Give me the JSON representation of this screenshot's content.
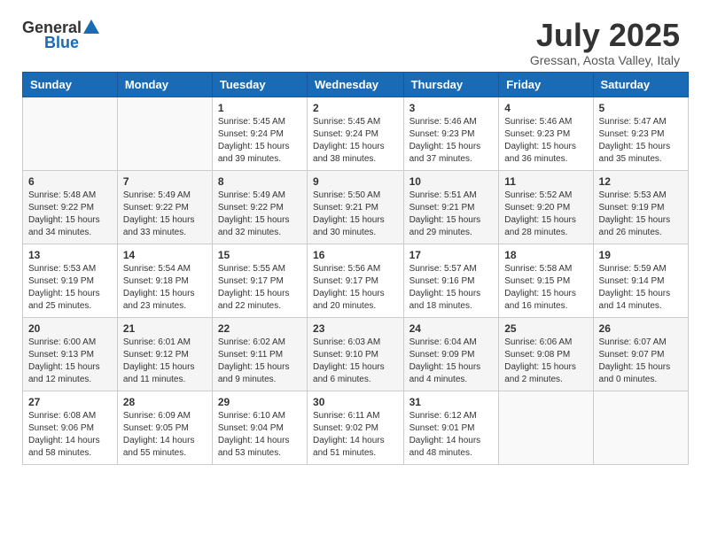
{
  "logo": {
    "general": "General",
    "blue": "Blue"
  },
  "title": "July 2025",
  "location": "Gressan, Aosta Valley, Italy",
  "headers": [
    "Sunday",
    "Monday",
    "Tuesday",
    "Wednesday",
    "Thursday",
    "Friday",
    "Saturday"
  ],
  "weeks": [
    [
      {
        "day": "",
        "info": ""
      },
      {
        "day": "",
        "info": ""
      },
      {
        "day": "1",
        "info": "Sunrise: 5:45 AM\nSunset: 9:24 PM\nDaylight: 15 hours and 39 minutes."
      },
      {
        "day": "2",
        "info": "Sunrise: 5:45 AM\nSunset: 9:24 PM\nDaylight: 15 hours and 38 minutes."
      },
      {
        "day": "3",
        "info": "Sunrise: 5:46 AM\nSunset: 9:23 PM\nDaylight: 15 hours and 37 minutes."
      },
      {
        "day": "4",
        "info": "Sunrise: 5:46 AM\nSunset: 9:23 PM\nDaylight: 15 hours and 36 minutes."
      },
      {
        "day": "5",
        "info": "Sunrise: 5:47 AM\nSunset: 9:23 PM\nDaylight: 15 hours and 35 minutes."
      }
    ],
    [
      {
        "day": "6",
        "info": "Sunrise: 5:48 AM\nSunset: 9:22 PM\nDaylight: 15 hours and 34 minutes."
      },
      {
        "day": "7",
        "info": "Sunrise: 5:49 AM\nSunset: 9:22 PM\nDaylight: 15 hours and 33 minutes."
      },
      {
        "day": "8",
        "info": "Sunrise: 5:49 AM\nSunset: 9:22 PM\nDaylight: 15 hours and 32 minutes."
      },
      {
        "day": "9",
        "info": "Sunrise: 5:50 AM\nSunset: 9:21 PM\nDaylight: 15 hours and 30 minutes."
      },
      {
        "day": "10",
        "info": "Sunrise: 5:51 AM\nSunset: 9:21 PM\nDaylight: 15 hours and 29 minutes."
      },
      {
        "day": "11",
        "info": "Sunrise: 5:52 AM\nSunset: 9:20 PM\nDaylight: 15 hours and 28 minutes."
      },
      {
        "day": "12",
        "info": "Sunrise: 5:53 AM\nSunset: 9:19 PM\nDaylight: 15 hours and 26 minutes."
      }
    ],
    [
      {
        "day": "13",
        "info": "Sunrise: 5:53 AM\nSunset: 9:19 PM\nDaylight: 15 hours and 25 minutes."
      },
      {
        "day": "14",
        "info": "Sunrise: 5:54 AM\nSunset: 9:18 PM\nDaylight: 15 hours and 23 minutes."
      },
      {
        "day": "15",
        "info": "Sunrise: 5:55 AM\nSunset: 9:17 PM\nDaylight: 15 hours and 22 minutes."
      },
      {
        "day": "16",
        "info": "Sunrise: 5:56 AM\nSunset: 9:17 PM\nDaylight: 15 hours and 20 minutes."
      },
      {
        "day": "17",
        "info": "Sunrise: 5:57 AM\nSunset: 9:16 PM\nDaylight: 15 hours and 18 minutes."
      },
      {
        "day": "18",
        "info": "Sunrise: 5:58 AM\nSunset: 9:15 PM\nDaylight: 15 hours and 16 minutes."
      },
      {
        "day": "19",
        "info": "Sunrise: 5:59 AM\nSunset: 9:14 PM\nDaylight: 15 hours and 14 minutes."
      }
    ],
    [
      {
        "day": "20",
        "info": "Sunrise: 6:00 AM\nSunset: 9:13 PM\nDaylight: 15 hours and 12 minutes."
      },
      {
        "day": "21",
        "info": "Sunrise: 6:01 AM\nSunset: 9:12 PM\nDaylight: 15 hours and 11 minutes."
      },
      {
        "day": "22",
        "info": "Sunrise: 6:02 AM\nSunset: 9:11 PM\nDaylight: 15 hours and 9 minutes."
      },
      {
        "day": "23",
        "info": "Sunrise: 6:03 AM\nSunset: 9:10 PM\nDaylight: 15 hours and 6 minutes."
      },
      {
        "day": "24",
        "info": "Sunrise: 6:04 AM\nSunset: 9:09 PM\nDaylight: 15 hours and 4 minutes."
      },
      {
        "day": "25",
        "info": "Sunrise: 6:06 AM\nSunset: 9:08 PM\nDaylight: 15 hours and 2 minutes."
      },
      {
        "day": "26",
        "info": "Sunrise: 6:07 AM\nSunset: 9:07 PM\nDaylight: 15 hours and 0 minutes."
      }
    ],
    [
      {
        "day": "27",
        "info": "Sunrise: 6:08 AM\nSunset: 9:06 PM\nDaylight: 14 hours and 58 minutes."
      },
      {
        "day": "28",
        "info": "Sunrise: 6:09 AM\nSunset: 9:05 PM\nDaylight: 14 hours and 55 minutes."
      },
      {
        "day": "29",
        "info": "Sunrise: 6:10 AM\nSunset: 9:04 PM\nDaylight: 14 hours and 53 minutes."
      },
      {
        "day": "30",
        "info": "Sunrise: 6:11 AM\nSunset: 9:02 PM\nDaylight: 14 hours and 51 minutes."
      },
      {
        "day": "31",
        "info": "Sunrise: 6:12 AM\nSunset: 9:01 PM\nDaylight: 14 hours and 48 minutes."
      },
      {
        "day": "",
        "info": ""
      },
      {
        "day": "",
        "info": ""
      }
    ]
  ]
}
